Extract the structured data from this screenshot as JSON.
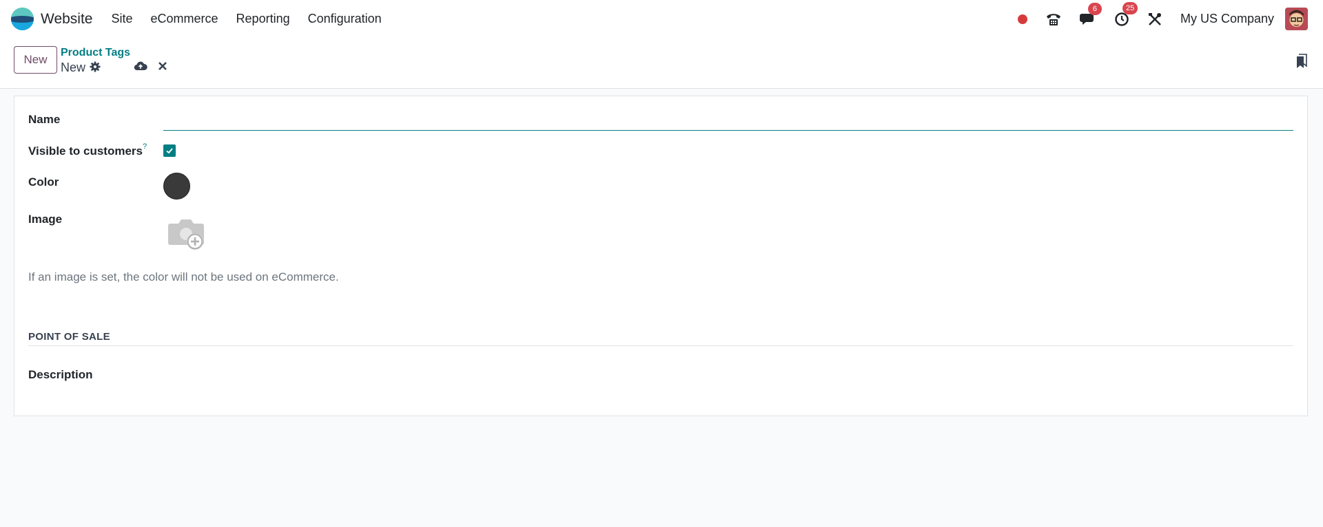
{
  "navbar": {
    "app_name": "Website",
    "menu": [
      "Site",
      "eCommerce",
      "Reporting",
      "Configuration"
    ],
    "messages_count": "6",
    "activities_count": "25",
    "company": "My US Company",
    "icons": [
      "record-dot-icon",
      "phone-icon",
      "chat-icon",
      "clock-icon",
      "tools-icon"
    ]
  },
  "control": {
    "new_button": "New",
    "breadcrumb": "Product Tags",
    "record_name": "New"
  },
  "form": {
    "name_label": "Name",
    "name_value": "",
    "visible_label": "Visible to customers",
    "visible_help": "?",
    "visible_checked": true,
    "color_label": "Color",
    "color_value": "#3a3a3a",
    "image_label": "Image",
    "image_note": "If an image is set, the color will not be used on eCommerce.",
    "section_title": "POINT OF SALE",
    "description_label": "Description"
  },
  "colors": {
    "accent": "#017e84",
    "primary": "#714b67",
    "badge": "#d9454f"
  }
}
